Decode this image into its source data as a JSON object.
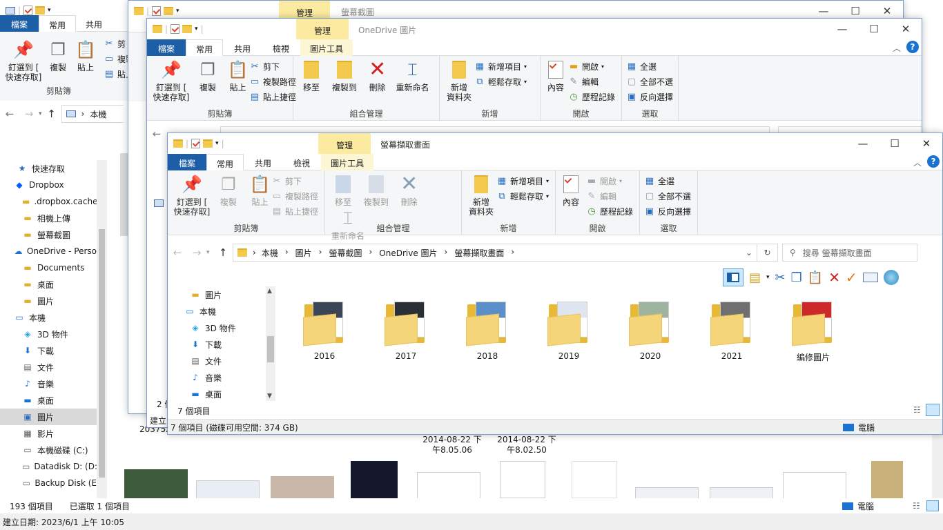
{
  "back": {
    "tabs": [
      "檔案",
      "常用",
      "共用"
    ],
    "manage": "管理",
    "title": "螢幕截圖",
    "clip_label": "剪貼簿",
    "pin": "釘選到 [\n快速存取]",
    "copy": "複製",
    "paste": "貼上",
    "cut": "剪",
    "copypath": "複製",
    "pasteshort": "貼上",
    "crumb": "本機",
    "nav_items": [
      {
        "icon": "star-icon",
        "label": "快速存取"
      },
      {
        "icon": "dropbox-icon",
        "label": "Dropbox"
      },
      {
        "icon": "folder-icon",
        "label": ".dropbox.cache"
      },
      {
        "icon": "folder-icon",
        "label": "相機上傳"
      },
      {
        "icon": "folder-icon",
        "label": "螢幕截圖"
      },
      {
        "icon": "cloud-icon",
        "label": "OneDrive - Perso"
      },
      {
        "icon": "folder-icon",
        "label": "Documents"
      },
      {
        "icon": "folder-icon",
        "label": "桌面"
      },
      {
        "icon": "folder-icon",
        "label": "圖片"
      },
      {
        "icon": "pc-icon",
        "label": "本機"
      },
      {
        "icon": "cube-icon",
        "label": "3D 物件"
      },
      {
        "icon": "download-icon",
        "label": "下載"
      },
      {
        "icon": "doc-icon",
        "label": "文件"
      },
      {
        "icon": "music-icon",
        "label": "音樂"
      },
      {
        "icon": "desktop-icon",
        "label": "桌面"
      },
      {
        "icon": "pictures-icon",
        "label": "圖片"
      },
      {
        "icon": "video-icon",
        "label": "影片"
      },
      {
        "icon": "drive-icon",
        "label": "本機磁碟 (C:)"
      },
      {
        "icon": "drive-icon",
        "label": "Datadisk D: (D:"
      },
      {
        "icon": "drive-icon",
        "label": "Backup Disk (E"
      }
    ],
    "status_count": "193 個項目",
    "status_sel": "已選取 1 個項目",
    "status_date": "建立日期: 2023/6/1 上午 10:05",
    "status_pc": "電腦",
    "date1": "2014-08-22 下\n午8.05.06",
    "date2": "2014-08-22 下\n午8.02.50",
    "partial_num": "203752",
    "partial_2": "2",
    "partial_build": "建立"
  },
  "mid": {
    "tabs": [
      "檔案",
      "常用",
      "共用",
      "檢視",
      "圖片工具"
    ],
    "manage": "管理",
    "title": "OneDrive 圖片",
    "groups": {
      "clip": "剪貼簿",
      "org": "組合管理",
      "new": "新增",
      "open": "開啟",
      "select": "選取"
    },
    "pin": "釘選到 [\n快速存取]",
    "copy": "複製",
    "paste": "貼上",
    "cut": "剪下",
    "copypath": "複製路徑",
    "pasteshort": "貼上捷徑",
    "moveto": "移至",
    "copyto": "複製到",
    "delete": "刪除",
    "rename": "重新命名",
    "newfolder": "新增\n資料夾",
    "newitem": "新增項目",
    "easyaccess": "輕鬆存取",
    "props": "內容",
    "open": "開啟",
    "edit": "編輯",
    "history": "歷程記錄",
    "selall": "全選",
    "selnone": "全部不選",
    "selinv": "反向選擇",
    "status_partial": "2 個",
    "status_build": "建立"
  },
  "front": {
    "tabs": [
      "檔案",
      "常用",
      "共用",
      "檢視",
      "圖片工具"
    ],
    "manage": "管理",
    "title": "螢幕擷取畫面",
    "groups": {
      "clip": "剪貼簿",
      "org": "組合管理",
      "new": "新增",
      "open": "開啟",
      "select": "選取"
    },
    "pin": "釘選到 [\n快速存取]",
    "copy": "複製",
    "paste": "貼上",
    "cut": "剪下",
    "copypath": "複製路徑",
    "pasteshort": "貼上捷徑",
    "moveto": "移至",
    "copyto": "複製到",
    "delete": "刪除",
    "rename": "重新命名",
    "newfolder": "新增\n資料夾",
    "newitem": "新增項目",
    "easyaccess": "輕鬆存取",
    "props": "內容",
    "open": "開啟",
    "edit": "編輯",
    "history": "歷程記錄",
    "selall": "全選",
    "selnone": "全部不選",
    "selinv": "反向選擇",
    "breadcrumb": [
      "本機",
      "圖片",
      "螢幕截圖",
      "OneDrive 圖片",
      "螢幕擷取畫面"
    ],
    "search_placeholder": "搜尋 螢幕擷取畫面",
    "nav_items": [
      {
        "icon": "folder-icon",
        "label": "圖片"
      },
      {
        "icon": "pc-icon",
        "label": "本機"
      },
      {
        "icon": "cube-icon",
        "label": "3D 物件"
      },
      {
        "icon": "download-icon",
        "label": "下載"
      },
      {
        "icon": "doc-icon",
        "label": "文件"
      },
      {
        "icon": "music-icon",
        "label": "音樂"
      },
      {
        "icon": "desktop-icon",
        "label": "桌面"
      }
    ],
    "folders": [
      "2016",
      "2017",
      "2018",
      "2019",
      "2020",
      "2021",
      "編修圖片"
    ],
    "item_count": "7 個項目",
    "status": "7 個項目 (磁碟可用空間: 374 GB)",
    "status_pc": "電腦"
  },
  "colors": {
    "file_tab": "#1c5fa6",
    "manage_tab": "#fbeaa0",
    "selected": "#cce8ff"
  }
}
